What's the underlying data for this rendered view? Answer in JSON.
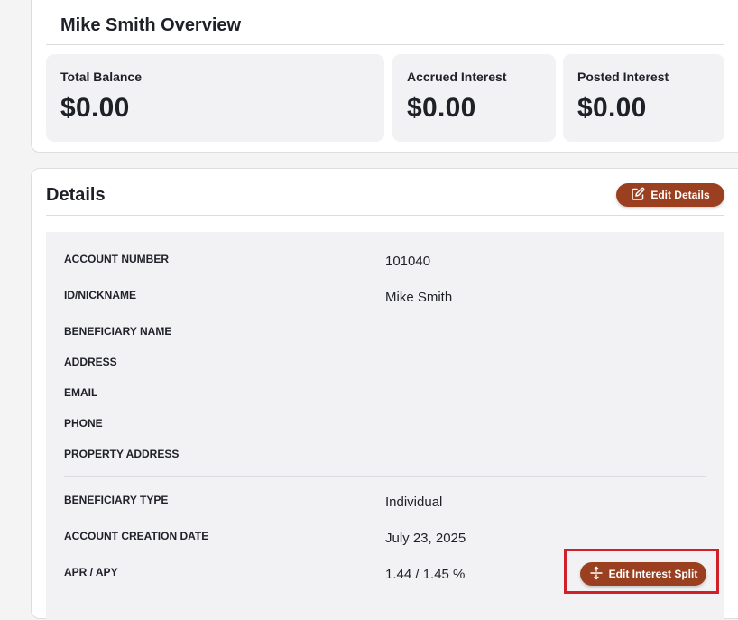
{
  "overview": {
    "title": "Mike Smith Overview",
    "stats": [
      {
        "label": "Total Balance",
        "value": "$0.00"
      },
      {
        "label": "Accrued Interest",
        "value": "$0.00"
      },
      {
        "label": "Posted Interest",
        "value": "$0.00"
      }
    ]
  },
  "details": {
    "title": "Details",
    "edit_button": "Edit Details",
    "rows": [
      {
        "label": "ACCOUNT NUMBER",
        "value": "101040"
      },
      {
        "label": "ID/NICKNAME",
        "value": "Mike Smith"
      },
      {
        "label": "BENEFICIARY NAME",
        "value": ""
      },
      {
        "label": "ADDRESS",
        "value": ""
      },
      {
        "label": "EMAIL",
        "value": ""
      },
      {
        "label": "PHONE",
        "value": ""
      },
      {
        "label": "PROPERTY ADDRESS",
        "value": ""
      },
      {
        "label": "BENEFICIARY TYPE",
        "value": "Individual"
      },
      {
        "label": "ACCOUNT CREATION DATE",
        "value": "July 23, 2025"
      },
      {
        "label": "APR / APY",
        "value": "1.44 / 1.45 %"
      }
    ],
    "split_button": "Edit Interest Split"
  },
  "icons": {
    "edit": "edit-icon",
    "split": "split-vertical-icon"
  },
  "colors": {
    "accent": "#9a4021",
    "highlight": "#d0202a"
  }
}
